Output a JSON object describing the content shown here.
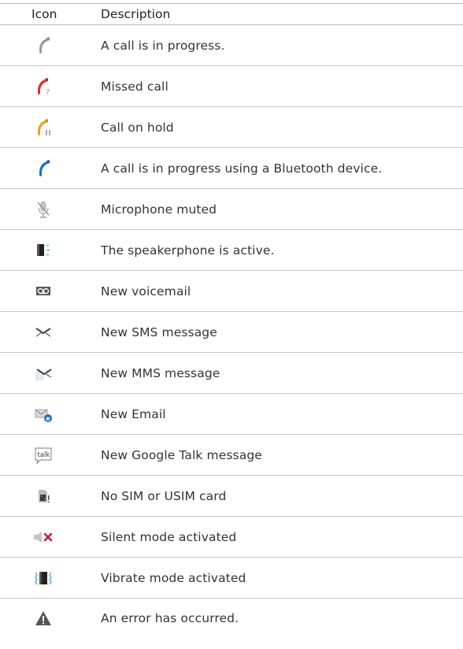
{
  "header": {
    "icon_label": "Icon",
    "description_label": "Description"
  },
  "rows": [
    {
      "icon": "phone-gray-icon",
      "description": "A call is in progress."
    },
    {
      "icon": "phone-missed-icon",
      "description": "Missed call"
    },
    {
      "icon": "phone-hold-icon",
      "description": "Call on hold"
    },
    {
      "icon": "phone-bluetooth-icon",
      "description": "A call is in progress using a Bluetooth device."
    },
    {
      "icon": "microphone-muted-icon",
      "description": "Microphone muted"
    },
    {
      "icon": "speakerphone-icon",
      "description": "The speakerphone is active."
    },
    {
      "icon": "voicemail-icon",
      "description": "New voicemail"
    },
    {
      "icon": "sms-icon",
      "description": "New SMS message"
    },
    {
      "icon": "mms-icon",
      "description": "New MMS message"
    },
    {
      "icon": "email-icon",
      "description": "New Email"
    },
    {
      "icon": "google-talk-icon",
      "description": "New Google Talk message",
      "icon_text": "talk"
    },
    {
      "icon": "no-sim-icon",
      "description": "No SIM or USIM card"
    },
    {
      "icon": "silent-mode-icon",
      "description": "Silent mode activated"
    },
    {
      "icon": "vibrate-mode-icon",
      "description": "Vibrate mode activated"
    },
    {
      "icon": "error-icon",
      "description": "An error has occurred."
    }
  ],
  "colors": {
    "missed": "#e0302a",
    "hold": "#f0a020",
    "bluetooth": "#1a6fd0",
    "gray": "#9a9a9a",
    "silent_x": "#c0203a"
  }
}
